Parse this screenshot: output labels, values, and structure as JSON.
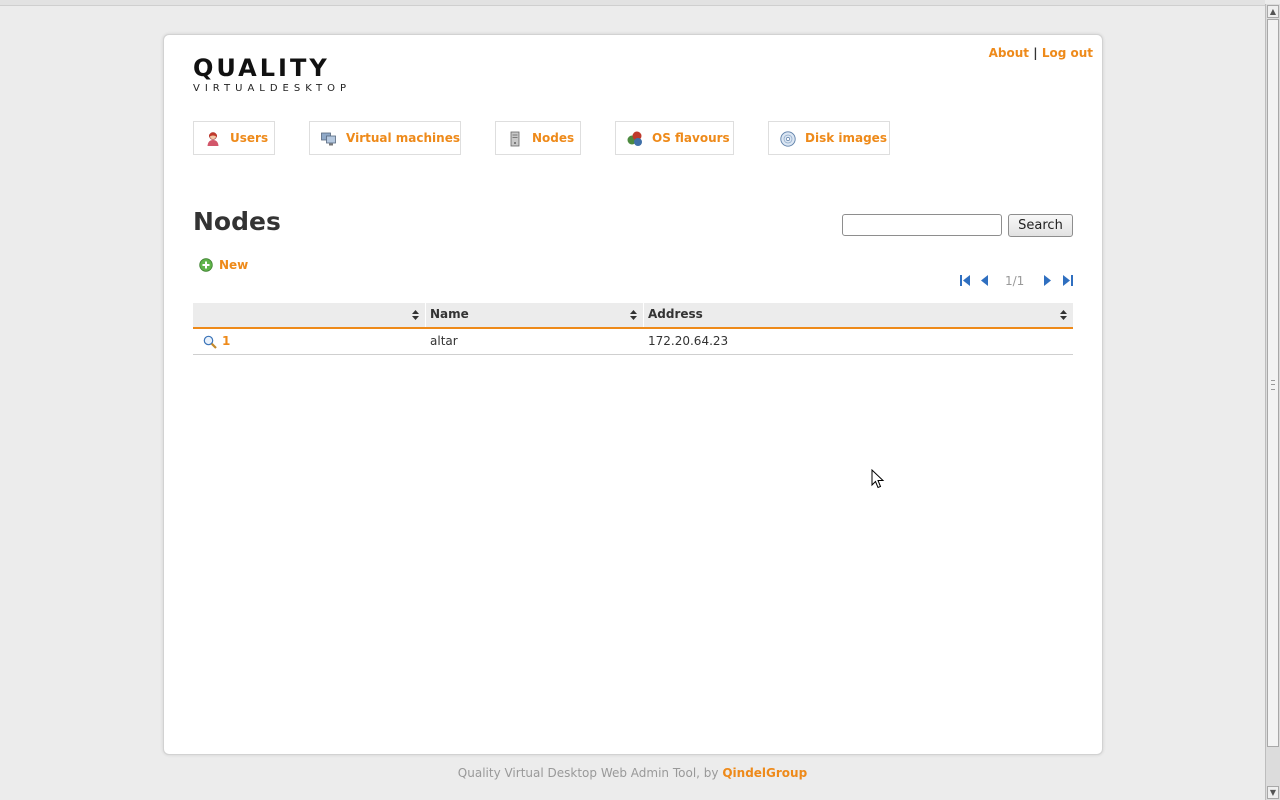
{
  "logo": {
    "main": "QUALITY",
    "sub": "VIRTUALDESKTOP"
  },
  "toplinks": {
    "about": "About",
    "separator": "|",
    "logout": "Log out"
  },
  "tabs": [
    {
      "label": "Users",
      "icon": "user-icon"
    },
    {
      "label": "Virtual machines",
      "icon": "computers-icon"
    },
    {
      "label": "Nodes",
      "icon": "server-icon"
    },
    {
      "label": "OS flavours",
      "icon": "os-flavours-icon"
    },
    {
      "label": "Disk images",
      "icon": "disk-icon"
    }
  ],
  "page": {
    "title": "Nodes"
  },
  "search": {
    "value": "",
    "button": "Search"
  },
  "actions": {
    "new_label": "New"
  },
  "pager": {
    "label": "1/1"
  },
  "table": {
    "columns": [
      "",
      "Name",
      "Address"
    ],
    "rows": [
      {
        "id": "1",
        "name": "altar",
        "address": "172.20.64.23"
      }
    ]
  },
  "footer": {
    "text": "Quality Virtual Desktop Web Admin Tool, by",
    "brand": "QindelGroup"
  },
  "colors": {
    "accent": "#ee8a1a",
    "background": "#ececec",
    "panel": "#ffffff"
  }
}
